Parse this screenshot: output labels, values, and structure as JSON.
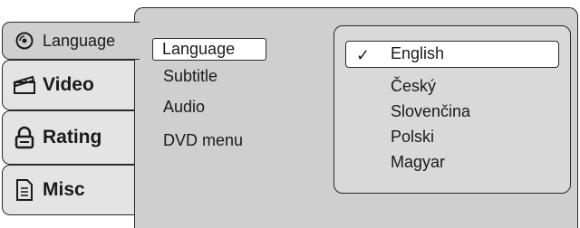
{
  "tabs": [
    {
      "label": "Language",
      "icon": "disc-icon",
      "active": true
    },
    {
      "label": "Video",
      "icon": "clapperboard-icon",
      "active": false
    },
    {
      "label": "Rating",
      "icon": "lock-icon",
      "active": false
    },
    {
      "label": "Misc",
      "icon": "document-icon",
      "active": false
    }
  ],
  "menu": {
    "items": [
      "Language",
      "Subtitle",
      "Audio",
      "DVD menu"
    ],
    "selected": "Language"
  },
  "submenu": {
    "check_glyph": "✓",
    "options": [
      "English",
      "Český",
      "Slovenčina",
      "Polski",
      "Magyar"
    ],
    "selected": "English"
  },
  "colors": {
    "panel": "#cfcfcf",
    "tab": "#e4e4e4",
    "border": "#2a2a2a",
    "highlight": "#ffffff"
  }
}
